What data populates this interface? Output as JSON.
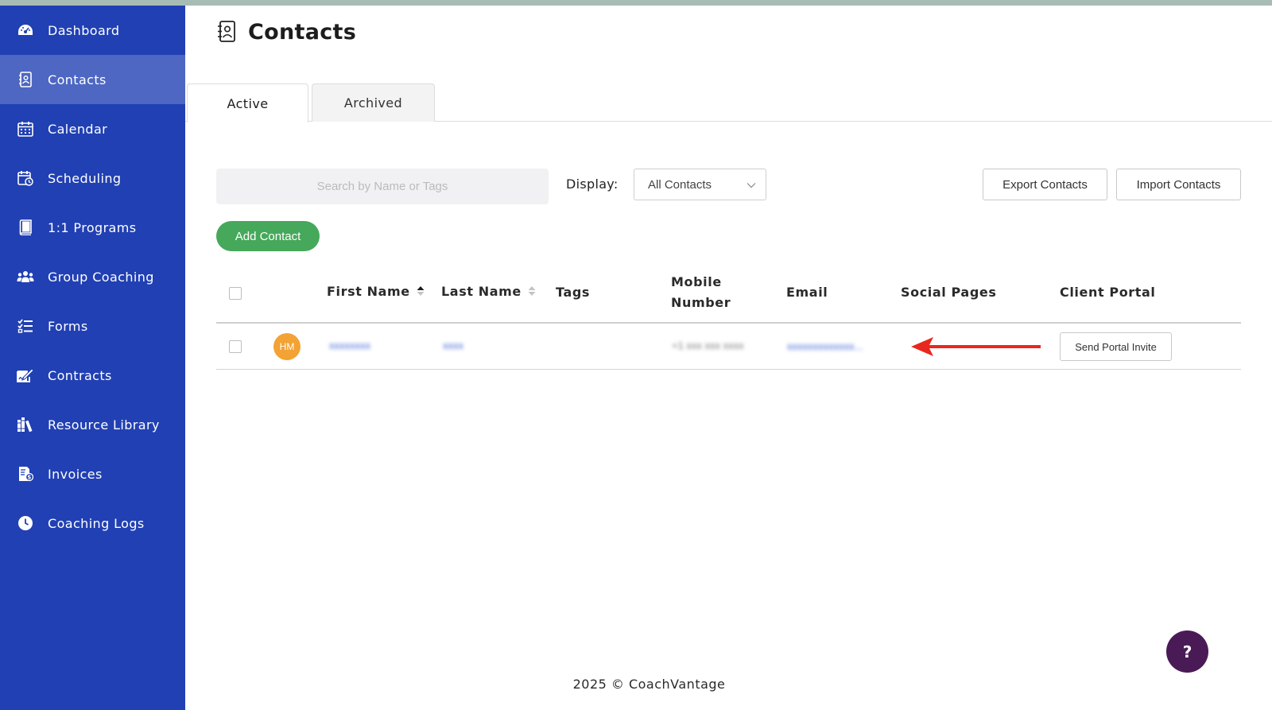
{
  "sidebar": {
    "items": [
      {
        "label": "Dashboard",
        "icon": "dashboard-icon"
      },
      {
        "label": "Contacts",
        "icon": "contacts-icon",
        "active": true
      },
      {
        "label": "Calendar",
        "icon": "calendar-icon"
      },
      {
        "label": "Scheduling",
        "icon": "scheduling-icon"
      },
      {
        "label": "1:1 Programs",
        "icon": "book-icon"
      },
      {
        "label": "Group Coaching",
        "icon": "group-icon"
      },
      {
        "label": "Forms",
        "icon": "checklist-icon"
      },
      {
        "label": "Contracts",
        "icon": "signature-icon"
      },
      {
        "label": "Resource Library",
        "icon": "library-icon"
      },
      {
        "label": "Invoices",
        "icon": "invoice-icon"
      },
      {
        "label": "Coaching Logs",
        "icon": "clock-icon"
      }
    ]
  },
  "header": {
    "title": "Contacts"
  },
  "tabs": [
    {
      "label": "Active",
      "active": true
    },
    {
      "label": "Archived",
      "active": false
    }
  ],
  "toolbar": {
    "search_placeholder": "Search by Name or Tags",
    "display_label": "Display:",
    "display_value": "All Contacts",
    "export_label": "Export Contacts",
    "import_label": "Import Contacts",
    "add_label": "Add Contact"
  },
  "table": {
    "columns": {
      "first_name": "First Name",
      "last_name": "Last Name",
      "tags": "Tags",
      "mobile_line1": "Mobile",
      "mobile_line2": "Number",
      "email": "Email",
      "social": "Social Pages",
      "portal": "Client Portal"
    },
    "rows": [
      {
        "initials": "HM",
        "first_name": "xxxxxxxx",
        "last_name": "xxxx",
        "mobile": "+1 xxx xxx xxxx",
        "email": "xxxxxxxxxxxxx...",
        "portal_button": "Send Portal Invite"
      }
    ]
  },
  "colors": {
    "sidebar": "#2140b3",
    "sidebar_active": "#4d67c2",
    "add_button": "#46a85a",
    "avatar": "#f3a234",
    "help_button": "#4a1a57",
    "arrow": "#e8281e"
  },
  "help_button_label": "?",
  "footer": {
    "text": "2025 © CoachVantage"
  }
}
